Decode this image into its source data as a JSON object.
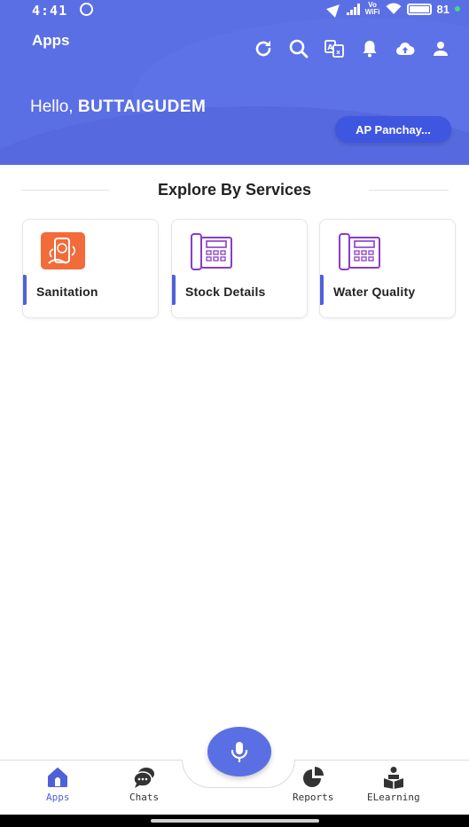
{
  "status_bar": {
    "time": "4:41",
    "volte": "Vo\nWiFi",
    "battery": "81"
  },
  "header": {
    "title": "Apps",
    "greeting_prefix": "Hello, ",
    "user_name": "BUTTAIGUDEM",
    "org_button": "AP Panchay...",
    "toolbar_icons": [
      "refresh-icon",
      "search-icon",
      "translate-icon",
      "bell-icon",
      "cloud-upload-icon",
      "profile-icon"
    ]
  },
  "section": {
    "title": "Explore By Services"
  },
  "services": [
    {
      "label": "Sanitation",
      "icon": "sanitation-icon"
    },
    {
      "label": "Stock Details",
      "icon": "telephone-icon"
    },
    {
      "label": "Water Quality",
      "icon": "telephone-icon"
    }
  ],
  "bottom_nav": {
    "items": [
      {
        "label": "Apps",
        "icon": "home-icon",
        "active": true
      },
      {
        "label": "Chats",
        "icon": "chat-icon",
        "active": false
      },
      {
        "label": "Reports",
        "icon": "pie-chart-icon",
        "active": false
      },
      {
        "label": "ELearning",
        "icon": "reading-icon",
        "active": false
      }
    ],
    "fab_icon": "mic-icon"
  },
  "colors": {
    "primary": "#5b6fe4",
    "button": "#3f56e0",
    "accent": "#4f61d8",
    "sanitation": "#f26b3a",
    "phone_icon": "#8a3cc9"
  }
}
